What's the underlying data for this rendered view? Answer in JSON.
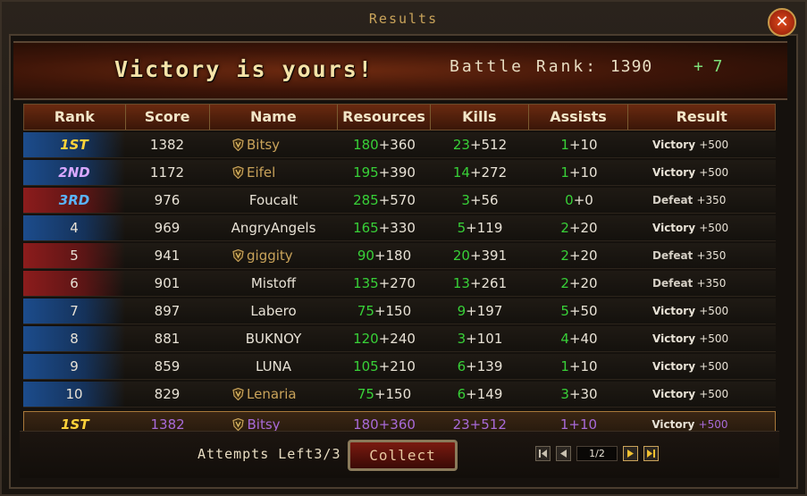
{
  "window": {
    "title": "Results"
  },
  "banner": {
    "victory_text": "Victory is yours!",
    "battle_rank_label": "Battle Rank:",
    "battle_rank_value": "1390",
    "rank_change": "+ 7"
  },
  "columns": [
    "Rank",
    "Score",
    "Name",
    "Resources",
    "Kills",
    "Assists",
    "Result"
  ],
  "rows": [
    {
      "rank": "1ST",
      "score": "1382",
      "name": "Bitsy",
      "res_base": "180",
      "res_bonus": "+360",
      "kills_base": "23",
      "kills_bonus": "+512",
      "assists_base": "1",
      "assists_bonus": "+10",
      "result": "Victory",
      "result_pts": "+500"
    },
    {
      "rank": "2ND",
      "score": "1172",
      "name": "Eifel",
      "res_base": "195",
      "res_bonus": "+390",
      "kills_base": "14",
      "kills_bonus": "+272",
      "assists_base": "1",
      "assists_bonus": "+10",
      "result": "Victory",
      "result_pts": "+500"
    },
    {
      "rank": "3RD",
      "score": "976",
      "name": "Foucalt",
      "res_base": "285",
      "res_bonus": "+570",
      "kills_base": "3",
      "kills_bonus": "+56",
      "assists_base": "0",
      "assists_bonus": "+0",
      "result": "Defeat",
      "result_pts": "+350"
    },
    {
      "rank": "4",
      "score": "969",
      "name": "AngryAngels",
      "res_base": "165",
      "res_bonus": "+330",
      "kills_base": "5",
      "kills_bonus": "+119",
      "assists_base": "2",
      "assists_bonus": "+20",
      "result": "Victory",
      "result_pts": "+500"
    },
    {
      "rank": "5",
      "score": "941",
      "name": "giggity",
      "res_base": "90",
      "res_bonus": "+180",
      "kills_base": "20",
      "kills_bonus": "+391",
      "assists_base": "2",
      "assists_bonus": "+20",
      "result": "Defeat",
      "result_pts": "+350"
    },
    {
      "rank": "6",
      "score": "901",
      "name": "Mistoff",
      "res_base": "135",
      "res_bonus": "+270",
      "kills_base": "13",
      "kills_bonus": "+261",
      "assists_base": "2",
      "assists_bonus": "+20",
      "result": "Defeat",
      "result_pts": "+350"
    },
    {
      "rank": "7",
      "score": "897",
      "name": "Labero",
      "res_base": "75",
      "res_bonus": "+150",
      "kills_base": "9",
      "kills_bonus": "+197",
      "assists_base": "5",
      "assists_bonus": "+50",
      "result": "Victory",
      "result_pts": "+500"
    },
    {
      "rank": "8",
      "score": "881",
      "name": "BUKNOY",
      "res_base": "120",
      "res_bonus": "+240",
      "kills_base": "3",
      "kills_bonus": "+101",
      "assists_base": "4",
      "assists_bonus": "+40",
      "result": "Victory",
      "result_pts": "+500"
    },
    {
      "rank": "9",
      "score": "859",
      "name": "LUNA",
      "res_base": "105",
      "res_bonus": "+210",
      "kills_base": "6",
      "kills_bonus": "+139",
      "assists_base": "1",
      "assists_bonus": "+10",
      "result": "Victory",
      "result_pts": "+500"
    },
    {
      "rank": "10",
      "score": "829",
      "name": "Lenaria",
      "res_base": "75",
      "res_bonus": "+150",
      "kills_base": "6",
      "kills_bonus": "+149",
      "assists_base": "3",
      "assists_bonus": "+30",
      "result": "Victory",
      "result_pts": "+500"
    }
  ],
  "my_row": {
    "rank": "1ST",
    "score": "1382",
    "name": "Bitsy",
    "resources": "180+360",
    "kills": "23+512",
    "assists": "1+10",
    "result": "Victory",
    "result_pts": "+500"
  },
  "footer": {
    "attempts_label": "Attempts Left",
    "attempts_value": "3/3",
    "collect_label": "Collect",
    "page_indicator": "1/2"
  },
  "colors": {
    "accent_gold": "#c9a35a",
    "stat_green": "#38d038",
    "self_purple": "#a86ad8",
    "ally_blue": "#1c4c8c",
    "enemy_red": "#8c1c1c"
  }
}
